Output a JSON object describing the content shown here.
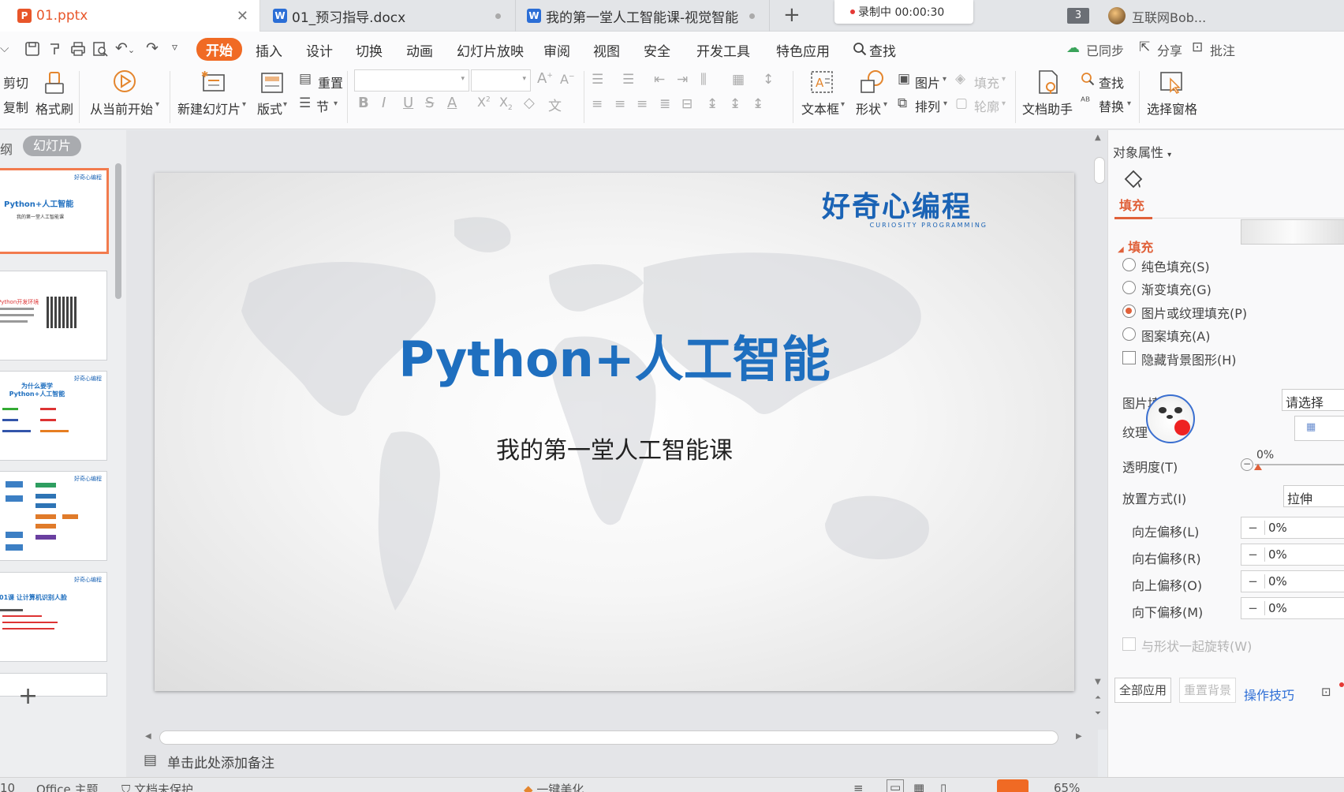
{
  "tabs": [
    {
      "label": "01.pptx",
      "type": "P"
    },
    {
      "label": "01_预习指导.docx",
      "type": "W"
    },
    {
      "label": "我的第一堂人工智能课-视觉智能",
      "type": "W"
    }
  ],
  "recording": {
    "label": "录制中 00:00:30"
  },
  "window_count": "3",
  "user": {
    "name": "互联网Bob..."
  },
  "menu": {
    "items": [
      "开始",
      "插入",
      "设计",
      "切换",
      "动画",
      "幻灯片放映",
      "审阅",
      "视图",
      "安全",
      "开发工具",
      "特色应用"
    ],
    "search": "查找",
    "sync": "已同步",
    "share": "分享",
    "comment": "批注"
  },
  "ribbon": {
    "cut": "剪切",
    "copy": "复制",
    "format_painter": "格式刷",
    "from_current": "从当前开始",
    "new_slide": "新建幻灯片",
    "layout": "版式",
    "reset": "重置",
    "section": "节",
    "text_box": "文本框",
    "shape": "形状",
    "picture": "图片",
    "arrange": "排列",
    "fill": "填充",
    "outline": "轮廓",
    "doc_assistant": "文档助手",
    "find": "查找",
    "replace": "替换",
    "selection_pane": "选择窗格"
  },
  "pane_tabs": {
    "outline": "纲",
    "slides": "幻灯片"
  },
  "thumbnails": [
    {
      "title": "Python+人工智能",
      "subtitle": "我的第一堂人工智能课"
    },
    {
      "title": "Python开发环境"
    },
    {
      "title": "为什么要学 Python+人工智能"
    },
    {
      "title": ""
    },
    {
      "title": "01课 让计算机识别人脸"
    }
  ],
  "slide": {
    "logo_cn": "好奇心编程",
    "logo_en": "CURIOSITY PROGRAMMING",
    "title": "Python+人工智能",
    "subtitle": "我的第一堂人工智能课"
  },
  "notes": {
    "placeholder": "单击此处添加备注"
  },
  "panel": {
    "header": "对象属性",
    "tab_fill": "填充",
    "section_fill": "填充",
    "options": [
      "纯色填充(S)",
      "渐变填充(G)",
      "图片或纹理填充(P)",
      "图案填充(A)"
    ],
    "selected_option": 2,
    "hide_bg": "隐藏背景图形(H)",
    "picture_fill_label": "图片填",
    "picture_select": "请选择",
    "texture_label": "纹理",
    "transparency_label": "透明度(T)",
    "transparency_value": "0%",
    "placement_label": "放置方式(I)",
    "placement_value": "拉伸",
    "offsets": [
      {
        "label": "向左偏移(L)",
        "value": "0%"
      },
      {
        "label": "向右偏移(R)",
        "value": "0%"
      },
      {
        "label": "向上偏移(O)",
        "value": "0%"
      },
      {
        "label": "向下偏移(M)",
        "value": "0%"
      }
    ],
    "rotate_with_shape": "与形状一起旋转(W)",
    "apply_all": "全部应用",
    "reset_bg": "重置背景",
    "tips": "操作技巧"
  },
  "status": {
    "slide_no": "10",
    "theme": "Office 主题",
    "protect": "文档未保护",
    "beautify": "一键美化",
    "zoom": "65%"
  },
  "colors": {
    "accent": "#f06a24",
    "title_blue": "#1f6fbf",
    "logo_blue": "#1a63b5"
  }
}
